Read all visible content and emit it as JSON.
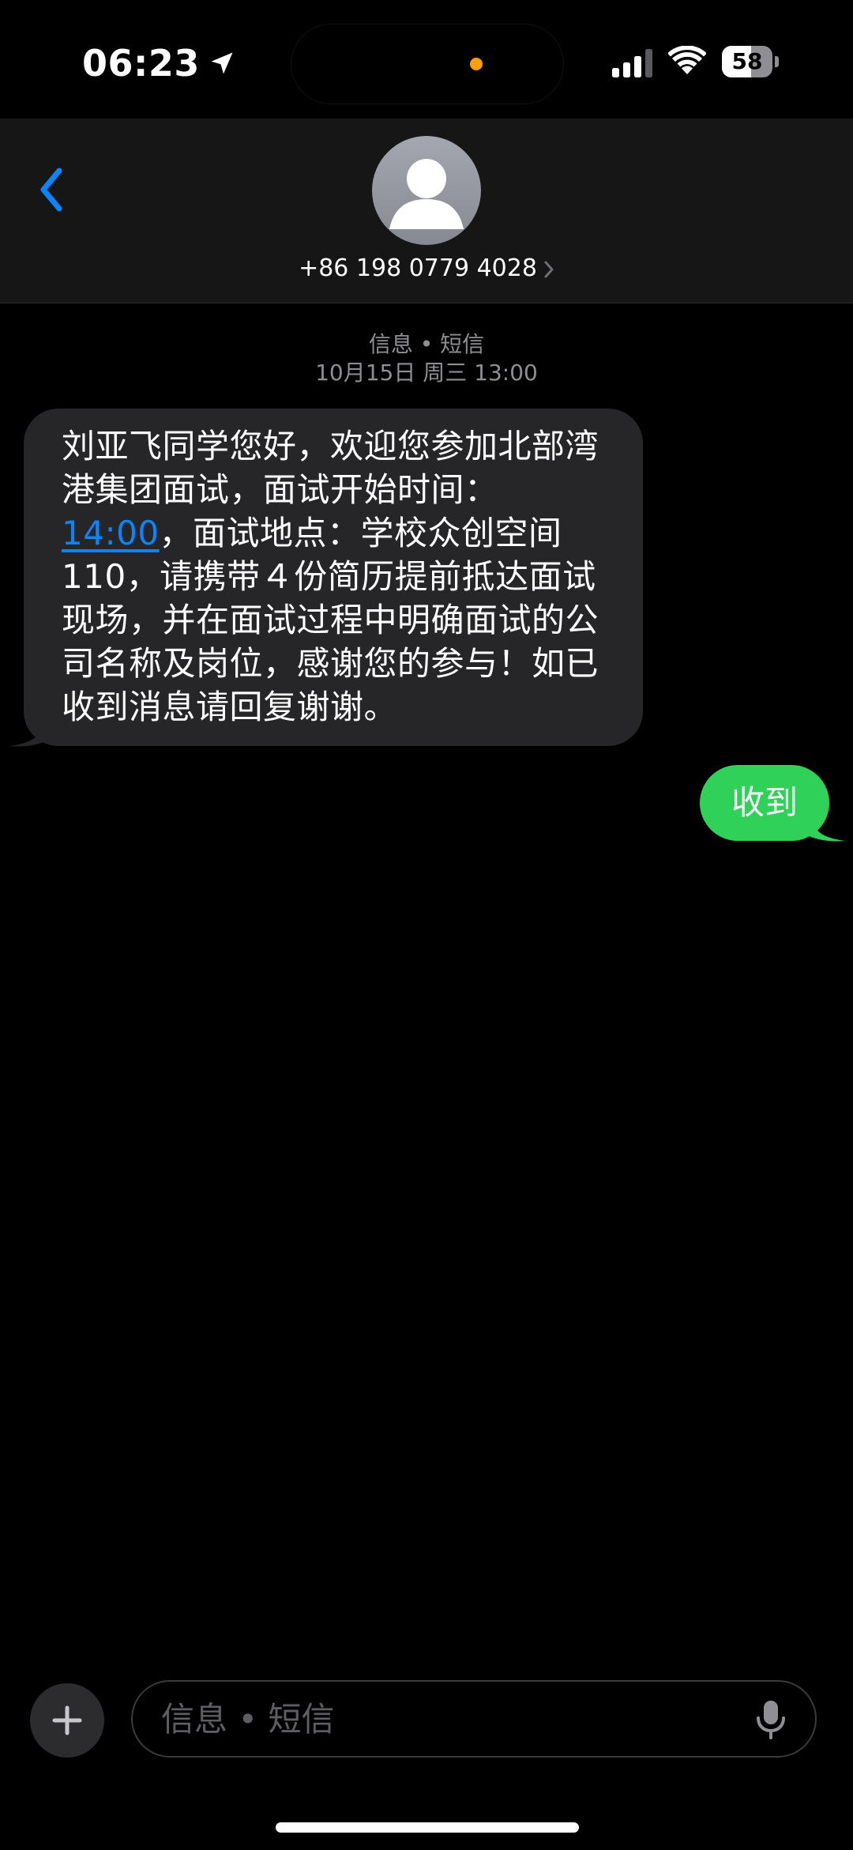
{
  "status_bar": {
    "time": "06:23",
    "battery_level": 58,
    "battery_text": "58",
    "icons": [
      "location-arrow-icon",
      "signal-icon",
      "wifi-icon",
      "battery-icon"
    ]
  },
  "header": {
    "back_icon": "chevron-left-icon",
    "contact_name": "+86 198 0779 4028",
    "contact_chevron_icon": "chevron-right-icon",
    "avatar_icon": "person-silhouette-icon"
  },
  "thread": {
    "service_label": "信息 • 短信",
    "timestamp": "10月15日 周三 13:00",
    "incoming_message": {
      "text_before_link": "刘亚飞同学您好，欢迎您参加北部湾港集团面试，面试开始时间：",
      "link_text": "14:00",
      "text_after_link": "，面试地点：学校众创空间110，请携带４份简历提前抵达面试现场，并在面试过程中明确面试的公司名称及岗位，感谢您的参与！如已收到消息请回复谢谢。"
    },
    "outgoing_message": {
      "text": "收到"
    }
  },
  "composer": {
    "plus_icon": "plus-icon",
    "placeholder": "信息 • 短信",
    "value": "",
    "mic_icon": "microphone-icon"
  },
  "colors": {
    "background": "#000000",
    "header_bg": "#161616",
    "incoming_bubble": "#262628",
    "outgoing_bubble": "#30d158",
    "link": "#0a84ff",
    "accent": "#0a84ff",
    "muted_text": "#8e8e93",
    "privacy_dot": "#ff9f0a"
  }
}
